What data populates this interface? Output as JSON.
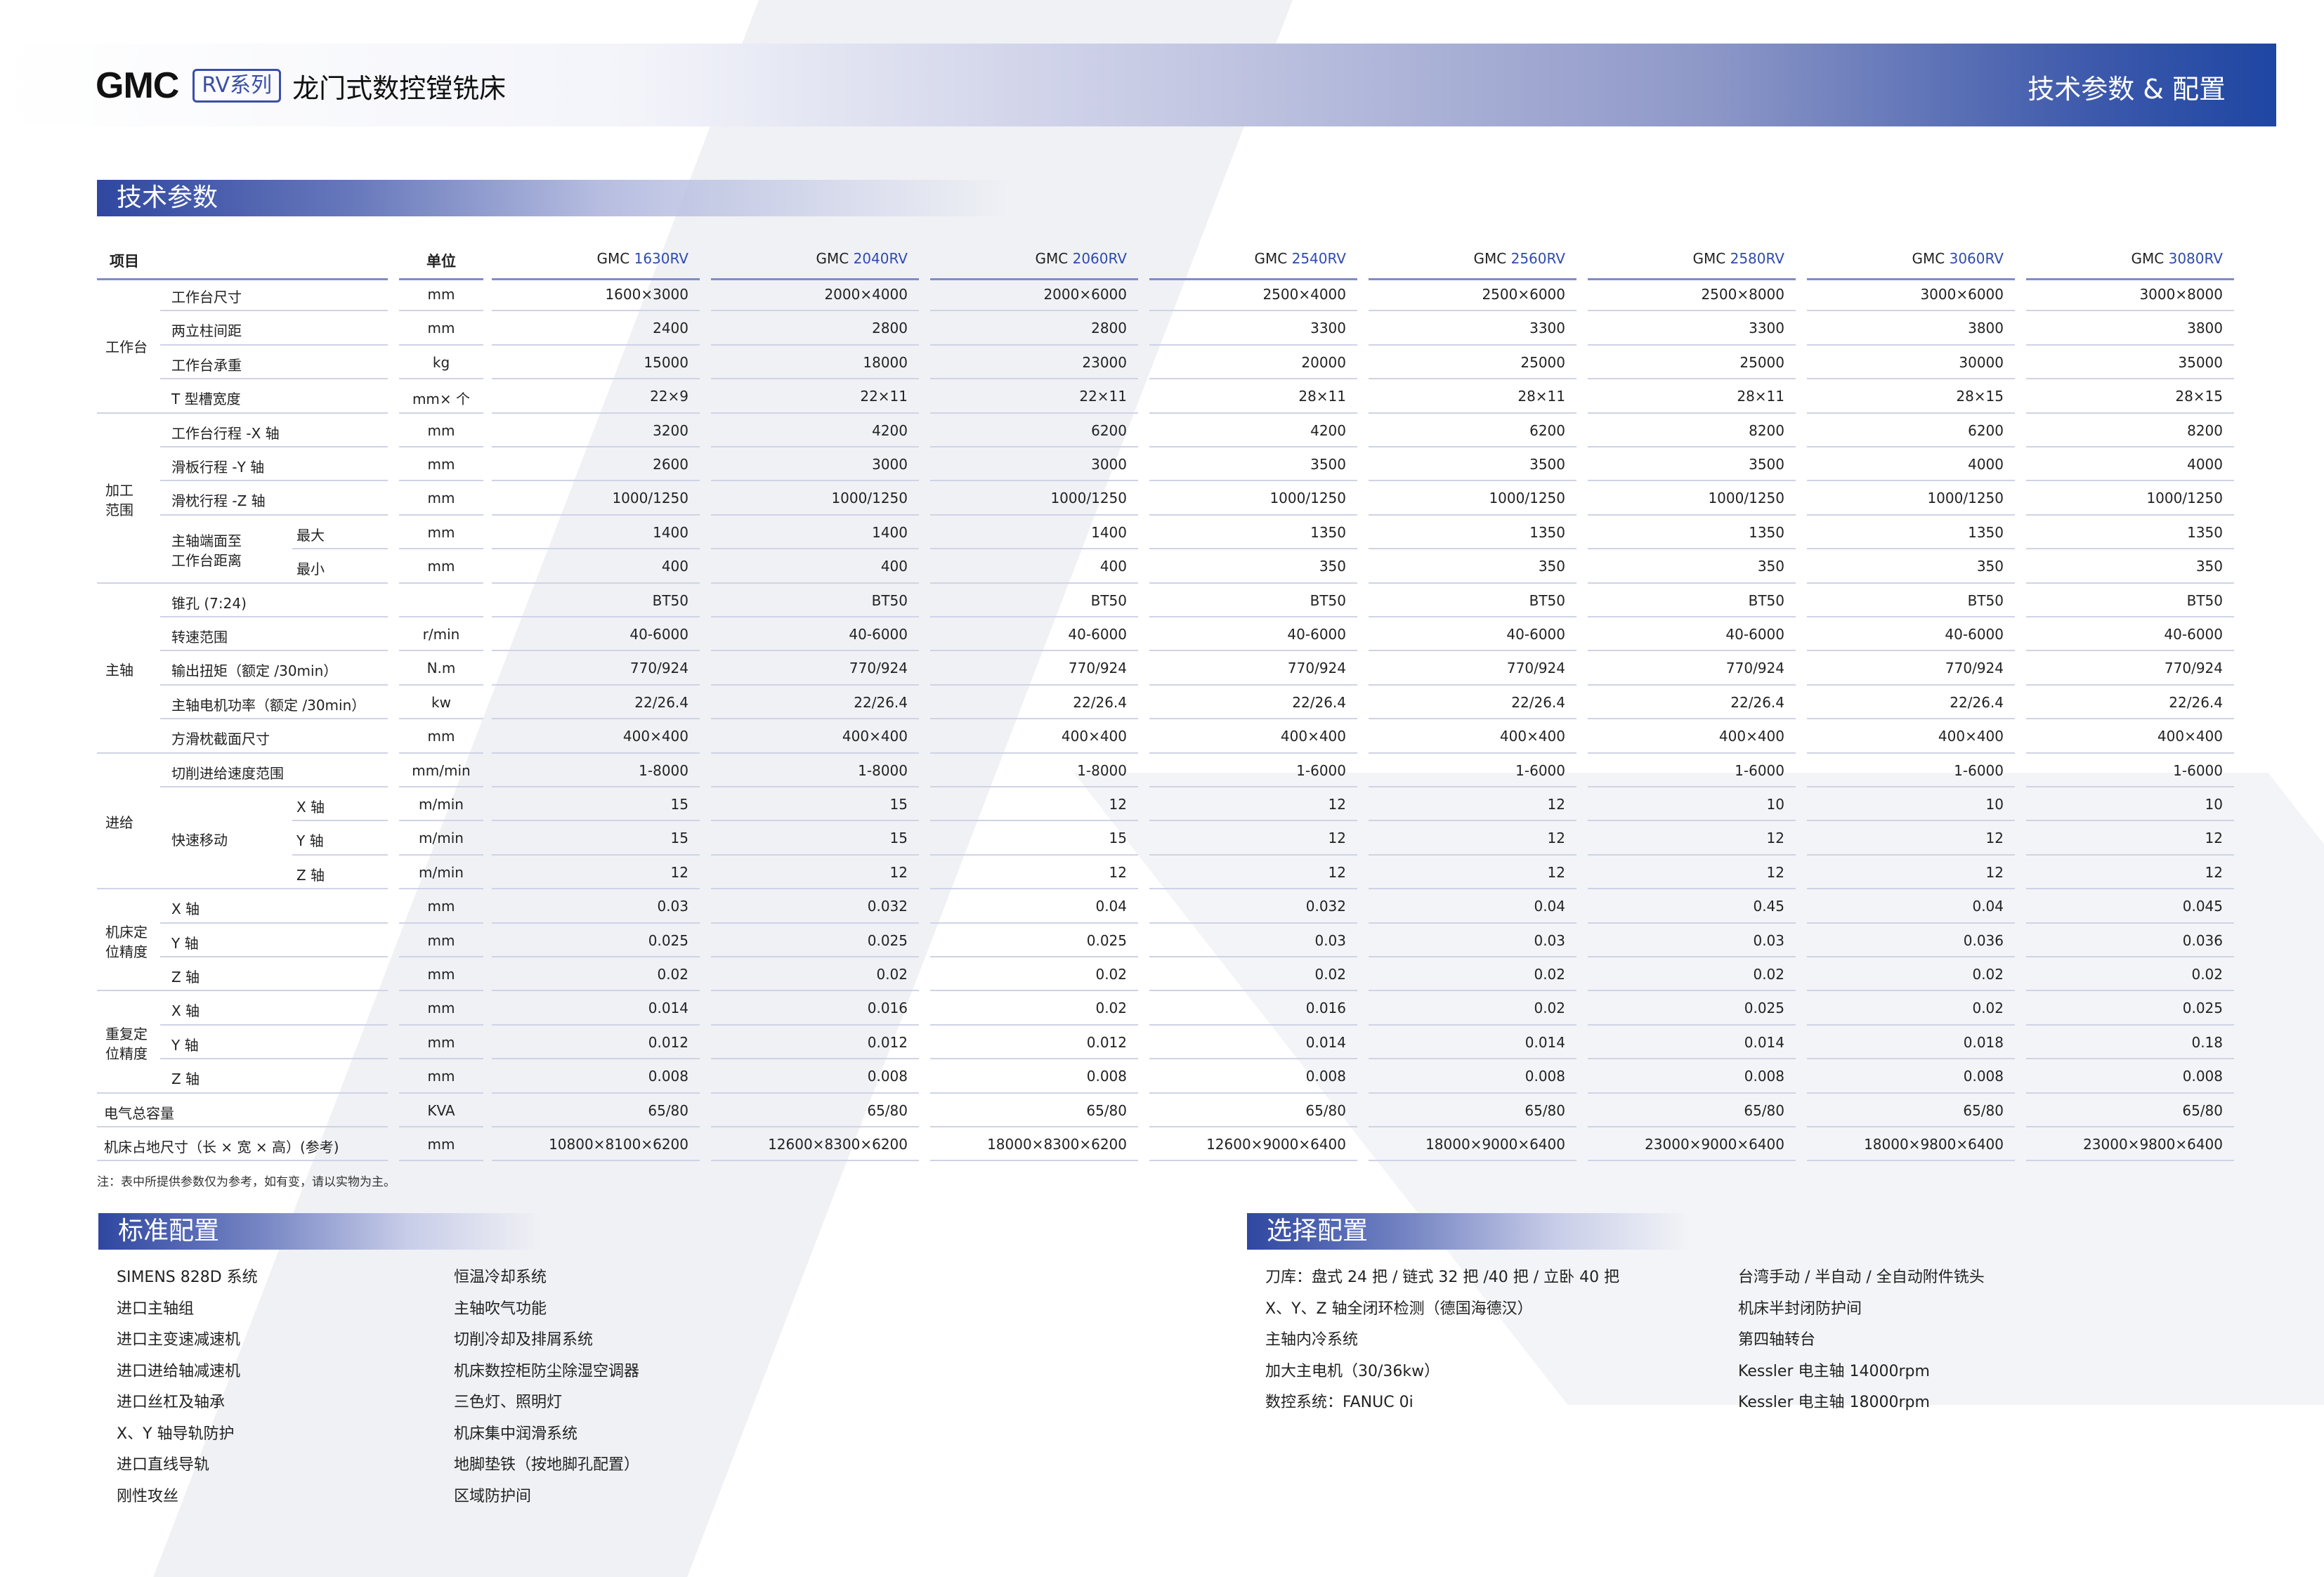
{
  "header": {
    "logo": "GMC",
    "series": "RV系列",
    "title": "龙门式数控镗铣床",
    "right_title": "技术参数 & 配置"
  },
  "tech_section": {
    "title": "技术参数"
  },
  "table": {
    "col_item": "项目",
    "col_unit": "单位",
    "models": [
      {
        "pre": "GMC ",
        "suf": "1630RV"
      },
      {
        "pre": "GMC ",
        "suf": "2040RV"
      },
      {
        "pre": "GMC ",
        "suf": "2060RV"
      },
      {
        "pre": "GMC ",
        "suf": "2540RV"
      },
      {
        "pre": "GMC ",
        "suf": "2560RV"
      },
      {
        "pre": "GMC ",
        "suf": "2580RV"
      },
      {
        "pre": "GMC ",
        "suf": "3060RV"
      },
      {
        "pre": "GMC ",
        "suf": "3080RV"
      }
    ],
    "groups": [
      {
        "label": "工作台",
        "rows": [
          0,
          3
        ]
      },
      {
        "label": "加工\n范围",
        "rows": [
          4,
          8
        ]
      },
      {
        "label": "主轴",
        "rows": [
          9,
          13
        ]
      },
      {
        "label": "进给",
        "rows": [
          14,
          17
        ]
      },
      {
        "label": "机床定\n位精度",
        "rows": [
          18,
          20
        ]
      },
      {
        "label": "重复定\n位精度",
        "rows": [
          21,
          23
        ]
      }
    ],
    "subgroups": [
      {
        "label": "主轴端面至\n工作台距离",
        "rows": [
          7,
          8
        ]
      },
      {
        "label": "快速移动",
        "rows": [
          15,
          17
        ]
      }
    ],
    "rows": [
      {
        "name": "工作台尺寸",
        "sub": "",
        "unit": "mm",
        "v": [
          "1600×3000",
          "2000×4000",
          "2000×6000",
          "2500×4000",
          "2500×6000",
          "2500×8000",
          "3000×6000",
          "3000×8000"
        ]
      },
      {
        "name": "两立柱间距",
        "sub": "",
        "unit": "mm",
        "v": [
          "2400",
          "2800",
          "2800",
          "3300",
          "3300",
          "3300",
          "3800",
          "3800"
        ]
      },
      {
        "name": "工作台承重",
        "sub": "",
        "unit": "kg",
        "v": [
          "15000",
          "18000",
          "23000",
          "20000",
          "25000",
          "25000",
          "30000",
          "35000"
        ]
      },
      {
        "name": "T 型槽宽度",
        "sub": "",
        "unit": "mm× 个",
        "v": [
          "22×9",
          "22×11",
          "22×11",
          "28×11",
          "28×11",
          "28×11",
          "28×15",
          "28×15"
        ]
      },
      {
        "name": "工作台行程 -X 轴",
        "sub": "",
        "unit": "mm",
        "v": [
          "3200",
          "4200",
          "6200",
          "4200",
          "6200",
          "8200",
          "6200",
          "8200"
        ]
      },
      {
        "name": "滑板行程 -Y 轴",
        "sub": "",
        "unit": "mm",
        "v": [
          "2600",
          "3000",
          "3000",
          "3500",
          "3500",
          "3500",
          "4000",
          "4000"
        ]
      },
      {
        "name": "滑枕行程 -Z 轴",
        "sub": "",
        "unit": "mm",
        "v": [
          "1000/1250",
          "1000/1250",
          "1000/1250",
          "1000/1250",
          "1000/1250",
          "1000/1250",
          "1000/1250",
          "1000/1250"
        ]
      },
      {
        "name": "",
        "sub": "最大",
        "unit": "mm",
        "v": [
          "1400",
          "1400",
          "1400",
          "1350",
          "1350",
          "1350",
          "1350",
          "1350"
        ]
      },
      {
        "name": "",
        "sub": "最小",
        "unit": "mm",
        "v": [
          "400",
          "400",
          "400",
          "350",
          "350",
          "350",
          "350",
          "350"
        ]
      },
      {
        "name": "锥孔 (7:24)",
        "sub": "",
        "unit": "",
        "v": [
          "BT50",
          "BT50",
          "BT50",
          "BT50",
          "BT50",
          "BT50",
          "BT50",
          "BT50"
        ]
      },
      {
        "name": "转速范围",
        "sub": "",
        "unit": "r/min",
        "v": [
          "40-6000",
          "40-6000",
          "40-6000",
          "40-6000",
          "40-6000",
          "40-6000",
          "40-6000",
          "40-6000"
        ]
      },
      {
        "name": "输出扭矩（额定 /30min）",
        "sub": "",
        "unit": "N.m",
        "v": [
          "770/924",
          "770/924",
          "770/924",
          "770/924",
          "770/924",
          "770/924",
          "770/924",
          "770/924"
        ]
      },
      {
        "name": "主轴电机功率（额定 /30min）",
        "sub": "",
        "unit": "kw",
        "v": [
          "22/26.4",
          "22/26.4",
          "22/26.4",
          "22/26.4",
          "22/26.4",
          "22/26.4",
          "22/26.4",
          "22/26.4"
        ]
      },
      {
        "name": "方滑枕截面尺寸",
        "sub": "",
        "unit": "mm",
        "v": [
          "400×400",
          "400×400",
          "400×400",
          "400×400",
          "400×400",
          "400×400",
          "400×400",
          "400×400"
        ]
      },
      {
        "name": "切削进给速度范围",
        "sub": "",
        "unit": "mm/min",
        "v": [
          "1-8000",
          "1-8000",
          "1-8000",
          "1-6000",
          "1-6000",
          "1-6000",
          "1-6000",
          "1-6000"
        ]
      },
      {
        "name": "",
        "sub": "X 轴",
        "unit": "m/min",
        "v": [
          "15",
          "15",
          "12",
          "12",
          "12",
          "10",
          "10",
          "10"
        ]
      },
      {
        "name": "",
        "sub": "Y 轴",
        "unit": "m/min",
        "v": [
          "15",
          "15",
          "15",
          "12",
          "12",
          "12",
          "12",
          "12"
        ]
      },
      {
        "name": "",
        "sub": "Z 轴",
        "unit": "m/min",
        "v": [
          "12",
          "12",
          "12",
          "12",
          "12",
          "12",
          "12",
          "12"
        ]
      },
      {
        "name": "X 轴",
        "sub": "",
        "unit": "mm",
        "v": [
          "0.03",
          "0.032",
          "0.04",
          "0.032",
          "0.04",
          "0.45",
          "0.04",
          "0.045"
        ]
      },
      {
        "name": "Y 轴",
        "sub": "",
        "unit": "mm",
        "v": [
          "0.025",
          "0.025",
          "0.025",
          "0.03",
          "0.03",
          "0.03",
          "0.036",
          "0.036"
        ]
      },
      {
        "name": "Z 轴",
        "sub": "",
        "unit": "mm",
        "v": [
          "0.02",
          "0.02",
          "0.02",
          "0.02",
          "0.02",
          "0.02",
          "0.02",
          "0.02"
        ]
      },
      {
        "name": "X 轴",
        "sub": "",
        "unit": "mm",
        "v": [
          "0.014",
          "0.016",
          "0.02",
          "0.016",
          "0.02",
          "0.025",
          "0.02",
          "0.025"
        ]
      },
      {
        "name": "Y 轴",
        "sub": "",
        "unit": "mm",
        "v": [
          "0.012",
          "0.012",
          "0.012",
          "0.014",
          "0.014",
          "0.014",
          "0.018",
          "0.18"
        ]
      },
      {
        "name": "Z 轴",
        "sub": "",
        "unit": "mm",
        "v": [
          "0.008",
          "0.008",
          "0.008",
          "0.008",
          "0.008",
          "0.008",
          "0.008",
          "0.008"
        ]
      },
      {
        "name": "电气总容量",
        "sub": "",
        "unit": "KVA",
        "full": true,
        "v": [
          "65/80",
          "65/80",
          "65/80",
          "65/80",
          "65/80",
          "65/80",
          "65/80",
          "65/80"
        ]
      },
      {
        "name": "机床占地尺寸（长 × 宽 × 高）(参考)",
        "sub": "",
        "unit": "mm",
        "full": true,
        "v": [
          "10800×8100×6200",
          "12600×8300×6200",
          "18000×8300×6200",
          "12600×9000×6400",
          "18000×9000×6400",
          "23000×9000×6400",
          "18000×9800×6400",
          "23000×9800×6400"
        ]
      }
    ]
  },
  "note": "注：表中所提供参数仅为参考，如有变，请以实物为主。",
  "standard_config": {
    "title": "标准配置",
    "col1": [
      "SIMENS 828D 系统",
      "进口主轴组",
      "进口主变速减速机",
      "进口进给轴减速机",
      "进口丝杠及轴承",
      "X、Y 轴导轨防护",
      "进口直线导轨",
      "刚性攻丝"
    ],
    "col2": [
      "恒温冷却系统",
      "主轴吹气功能",
      "切削冷却及排屑系统",
      "机床数控柜防尘除湿空调器",
      "三色灯、照明灯",
      "机床集中润滑系统",
      "地脚垫铁（按地脚孔配置）",
      "区域防护间"
    ]
  },
  "optional_config": {
    "title": "选择配置",
    "col1": [
      "刀库：盘式 24 把 / 链式 32 把 /40 把 / 立卧 40 把",
      "X、Y、Z 轴全闭环检测（德国海德汉）",
      "主轴内冷系统",
      "加大主电机（30/36kw）",
      "数控系统：FANUC 0i"
    ],
    "col2": [
      "台湾手动 / 半自动 / 全自动附件铣头",
      "机床半封闭防护间",
      "第四轴转台",
      "Kessler 电主轴 14000rpm",
      "Kessler 电主轴 18000rpm"
    ]
  }
}
